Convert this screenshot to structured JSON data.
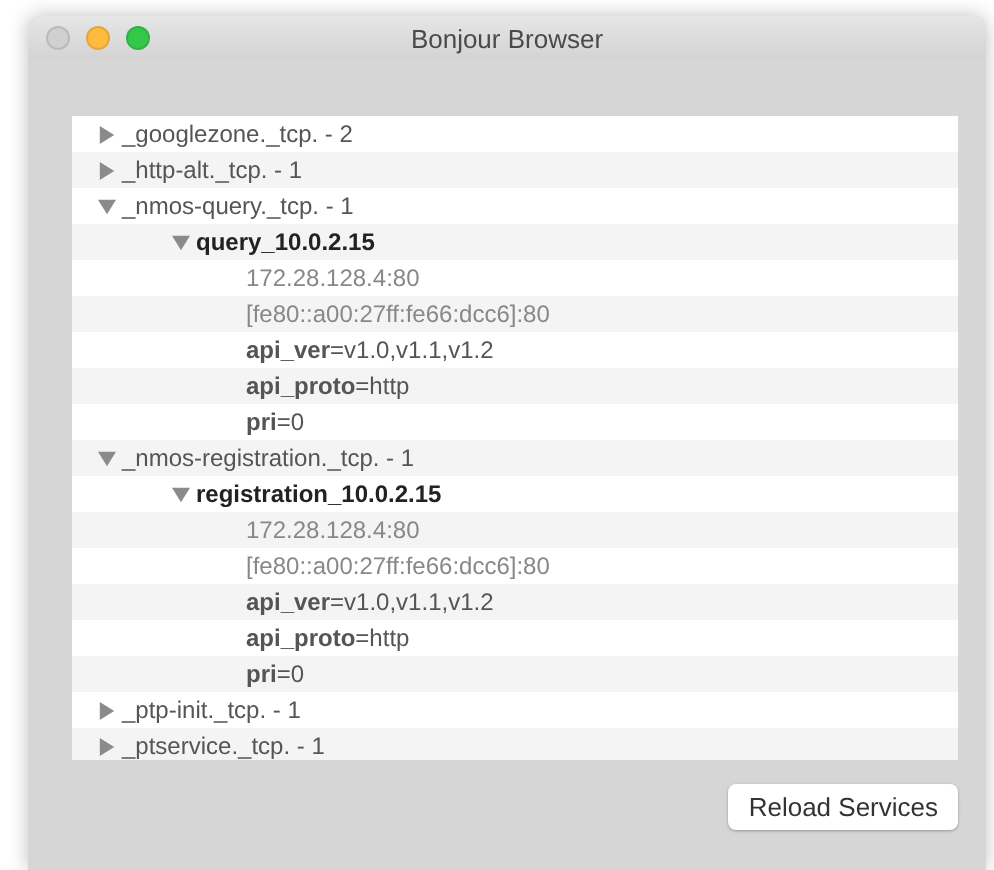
{
  "window": {
    "title": "Bonjour Browser"
  },
  "services": [
    {
      "label": "_googlezone._tcp. - 2",
      "expanded": false
    },
    {
      "label": "_http-alt._tcp. - 1",
      "expanded": false
    },
    {
      "label": "_nmos-query._tcp. - 1",
      "expanded": true,
      "instances": [
        {
          "label": "query_10.0.2.15",
          "expanded": true,
          "lines": [
            {
              "kind": "address",
              "text": "172.28.128.4:80"
            },
            {
              "kind": "address",
              "text": "[fe80::a00:27ff:fe66:dcc6]:80"
            },
            {
              "kind": "record",
              "text": "**api_ver**=v1.0,v1.1,v1.2"
            },
            {
              "kind": "record",
              "text": "**api_proto**=http"
            },
            {
              "kind": "record",
              "text": "**pri**=0"
            }
          ]
        }
      ]
    },
    {
      "label": "_nmos-registration._tcp. - 1",
      "expanded": true,
      "instances": [
        {
          "label": "registration_10.0.2.15",
          "expanded": true,
          "lines": [
            {
              "kind": "address",
              "text": "172.28.128.4:80"
            },
            {
              "kind": "address",
              "text": "[fe80::a00:27ff:fe66:dcc6]:80"
            },
            {
              "kind": "record",
              "text": "**api_ver**=v1.0,v1.1,v1.2"
            },
            {
              "kind": "record",
              "text": "**api_proto**=http"
            },
            {
              "kind": "record",
              "text": "**pri**=0"
            }
          ]
        }
      ]
    },
    {
      "label": "_ptp-init._tcp. - 1",
      "expanded": false
    },
    {
      "label": "_ptservice._tcp. - 1",
      "expanded": false
    }
  ],
  "buttons": [
    {
      "label": "Reload Services"
    }
  ]
}
